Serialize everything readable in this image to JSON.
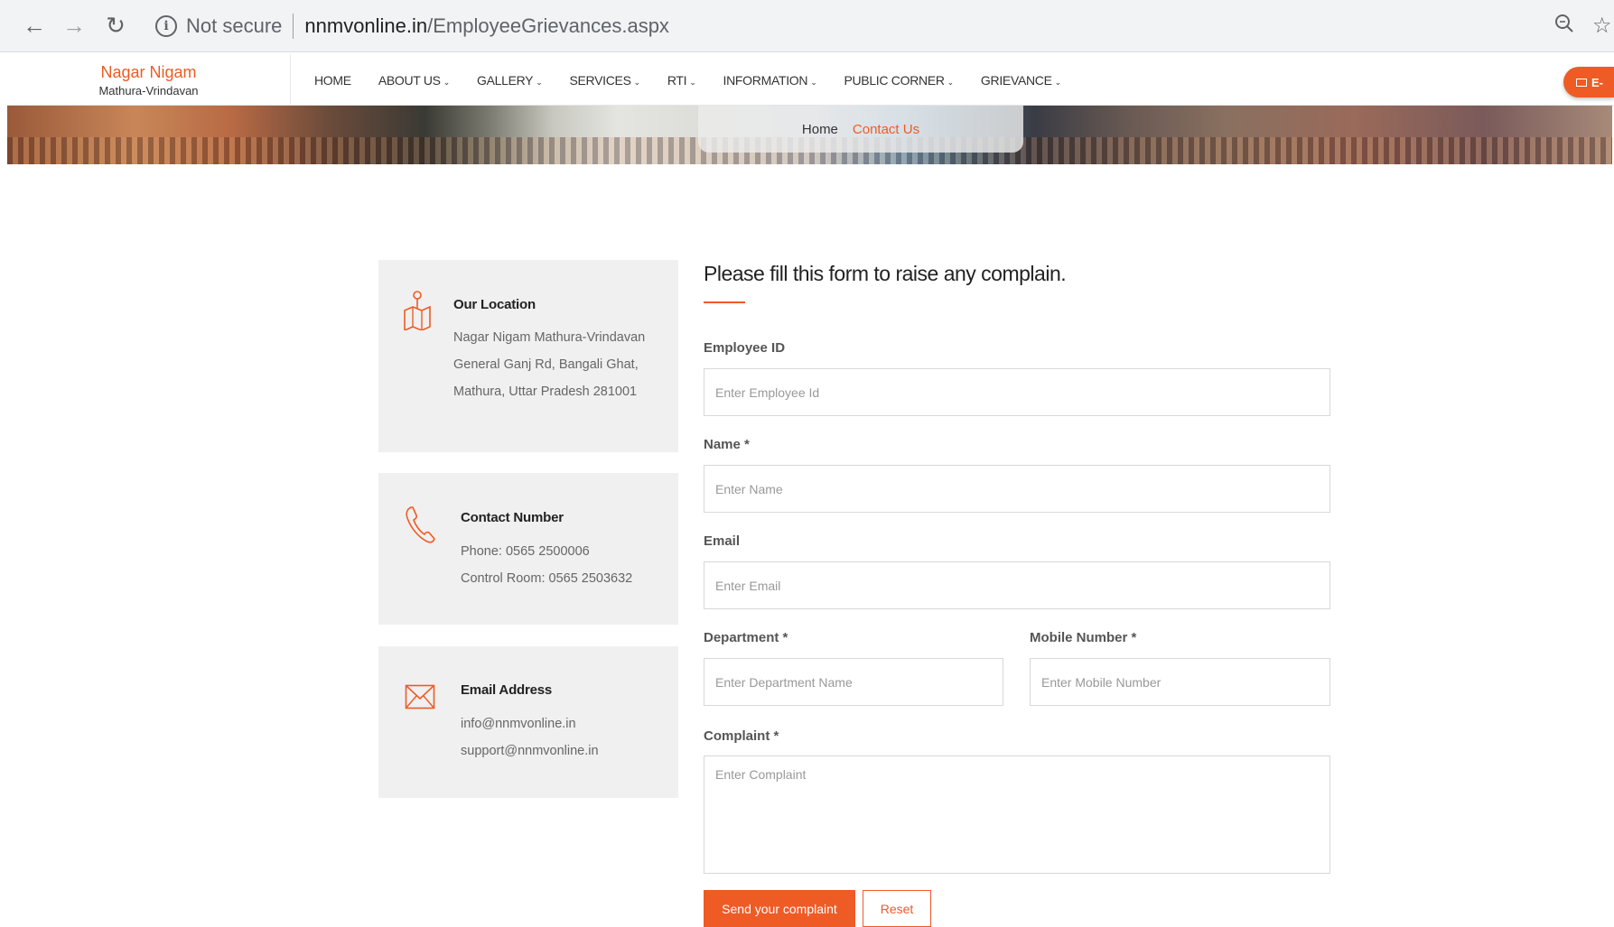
{
  "browser": {
    "security_label": "Not secure",
    "url_host": "nnmvonline.in",
    "url_path": "/EmployeeGrievances.aspx"
  },
  "site": {
    "logo_line1": "Nagar Nigam",
    "logo_line2": "Mathura-Vrindavan",
    "menu": [
      {
        "label": "HOME",
        "has_dropdown": false
      },
      {
        "label": "ABOUT US",
        "has_dropdown": true
      },
      {
        "label": "GALLERY",
        "has_dropdown": true
      },
      {
        "label": "SERVICES",
        "has_dropdown": true
      },
      {
        "label": "RTI",
        "has_dropdown": true
      },
      {
        "label": "INFORMATION",
        "has_dropdown": true
      },
      {
        "label": "PUBLIC CORNER",
        "has_dropdown": true
      },
      {
        "label": "GRIEVANCE",
        "has_dropdown": true
      }
    ],
    "corner_button_label": "E-"
  },
  "breadcrumb": {
    "home": "Home",
    "current": "Contact Us"
  },
  "contact_cards": {
    "location": {
      "title": "Our Location",
      "lines": [
        "Nagar Nigam Mathura-Vrindavan",
        "General Ganj Rd, Bangali Ghat,",
        "Mathura, Uttar Pradesh 281001"
      ]
    },
    "phone": {
      "title": "Contact Number",
      "lines": [
        "Phone: 0565 2500006",
        "Control Room: 0565 2503632"
      ]
    },
    "email": {
      "title": "Email Address",
      "lines": [
        "info@nnmvonline.in",
        "support@nnmvonline.in"
      ]
    }
  },
  "form": {
    "title": "Please fill this form to raise any complain.",
    "employee_id": {
      "label": "Employee ID",
      "placeholder": "Enter Employee Id",
      "value": ""
    },
    "name": {
      "label": "Name *",
      "placeholder": "Enter Name",
      "value": ""
    },
    "email": {
      "label": "Email",
      "placeholder": "Enter Email",
      "value": ""
    },
    "department": {
      "label": "Department *",
      "placeholder": "Enter Department Name",
      "value": ""
    },
    "mobile": {
      "label": "Mobile Number *",
      "placeholder": "Enter Mobile Number",
      "value": ""
    },
    "complaint": {
      "label": "Complaint *",
      "placeholder": "Enter Complaint",
      "value": ""
    },
    "submit_label": "Send your complaint",
    "reset_label": "Reset"
  },
  "colors": {
    "accent": "#ef5b25",
    "card_bg": "#f0f0f0"
  }
}
